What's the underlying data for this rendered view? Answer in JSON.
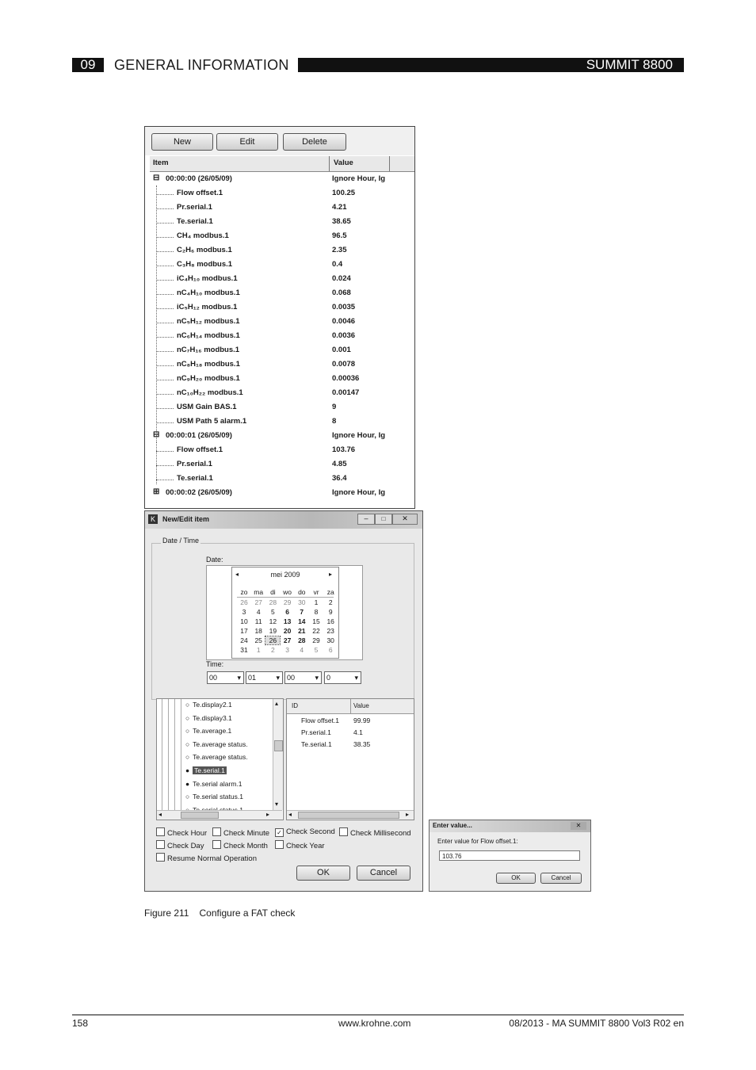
{
  "header": {
    "section_number": "09",
    "section_title": "GENERAL INFORMATION",
    "product": "SUMMIT 8800"
  },
  "panel1": {
    "buttons": {
      "new": "New",
      "edit": "Edit",
      "delete": "Delete"
    },
    "columns": {
      "item": "Item",
      "value": "Value"
    },
    "rows": [
      {
        "label": "00:00:00 (26/05/09)",
        "value": "Ignore Hour, Ig",
        "level": 0,
        "expander": "⊟"
      },
      {
        "label": "Flow offset.1",
        "value": "100.25",
        "level": 1
      },
      {
        "label": "Pr.serial.1",
        "value": "4.21",
        "level": 1
      },
      {
        "label": "Te.serial.1",
        "value": "38.65",
        "level": 1
      },
      {
        "label": "CH₄ modbus.1",
        "value": "96.5",
        "level": 1
      },
      {
        "label": "C₂H₆ modbus.1",
        "value": "2.35",
        "level": 1
      },
      {
        "label": "C₃H₈ modbus.1",
        "value": "0.4",
        "level": 1
      },
      {
        "label": "iC₄H₁₀ modbus.1",
        "value": "0.024",
        "level": 1
      },
      {
        "label": "nC₄H₁₀ modbus.1",
        "value": "0.068",
        "level": 1
      },
      {
        "label": "iC₅H₁₂ modbus.1",
        "value": "0.0035",
        "level": 1
      },
      {
        "label": "nC₅H₁₂ modbus.1",
        "value": "0.0046",
        "level": 1
      },
      {
        "label": "nC₆H₁₄ modbus.1",
        "value": "0.0036",
        "level": 1
      },
      {
        "label": "nC₇H₁₆ modbus.1",
        "value": "0.001",
        "level": 1
      },
      {
        "label": "nC₈H₁₈ modbus.1",
        "value": "0.0078",
        "level": 1
      },
      {
        "label": "nC₉H₂₀ modbus.1",
        "value": "0.00036",
        "level": 1
      },
      {
        "label": "nC₁₀H₂₂ modbus.1",
        "value": "0.00147",
        "level": 1
      },
      {
        "label": "USM Gain BAS.1",
        "value": "9",
        "level": 1
      },
      {
        "label": "USM Path 5 alarm.1",
        "value": "8",
        "level": 1
      },
      {
        "label": "00:00:01 (26/05/09)",
        "value": "Ignore Hour, Ig",
        "level": 0,
        "expander": "⊟"
      },
      {
        "label": "Flow offset.1",
        "value": "103.76",
        "level": 1
      },
      {
        "label": "Pr.serial.1",
        "value": "4.85",
        "level": 1
      },
      {
        "label": "Te.serial.1",
        "value": "36.4",
        "level": 1
      },
      {
        "label": "00:00:02 (26/05/09)",
        "value": "Ignore Hour, Ig",
        "level": 0,
        "expander": "⊞"
      }
    ]
  },
  "panel2": {
    "title": "New/Edit item",
    "group_label": "Date / Time",
    "date_label": "Date:",
    "time_label": "Time:",
    "calendar": {
      "month": "mei 2009",
      "weekdays": [
        "zo",
        "ma",
        "di",
        "wo",
        "do",
        "vr",
        "za"
      ],
      "weeks": [
        [
          "26",
          "27",
          "28",
          "29",
          "30",
          "1",
          "2"
        ],
        [
          "3",
          "4",
          "5",
          "6",
          "7",
          "8",
          "9"
        ],
        [
          "10",
          "11",
          "12",
          "13",
          "14",
          "15",
          "16"
        ],
        [
          "17",
          "18",
          "19",
          "20",
          "21",
          "22",
          "23"
        ],
        [
          "24",
          "25",
          "26",
          "27",
          "28",
          "29",
          "30"
        ],
        [
          "31",
          "1",
          "2",
          "3",
          "4",
          "5",
          "6"
        ]
      ]
    },
    "time_values": [
      "00",
      "01",
      "00",
      "0"
    ],
    "tree_items": [
      "Te.display2.1",
      "Te.display3.1",
      "Te.average.1",
      "Te.average status.",
      "Te.average status.",
      "Te.serial.1",
      "Te.serial alarm.1",
      "Te.serial status.1",
      "Te.serial status.1"
    ],
    "list_columns": {
      "id": "ID",
      "value": "Value"
    },
    "list_rows": [
      {
        "id": "Flow offset.1",
        "value": "99.99"
      },
      {
        "id": "Pr.serial.1",
        "value": "4.1"
      },
      {
        "id": "Te.serial.1",
        "value": "38.35"
      }
    ],
    "checks": {
      "hour": "Check Hour",
      "minute": "Check Minute",
      "second": "Check Second",
      "millisecond": "Check Millisecond",
      "day": "Check Day",
      "month": "Check Month",
      "year": "Check Year",
      "resume": "Resume Normal Operation"
    },
    "ok": "OK",
    "cancel": "Cancel"
  },
  "panel3": {
    "title": "Enter value...",
    "prompt": "Enter value for Flow offset.1:",
    "input_value": "103.76",
    "ok": "OK",
    "cancel": "Cancel"
  },
  "caption": {
    "number": "Figure 211",
    "text": "Configure a FAT check"
  },
  "footer": {
    "page": "158",
    "url": "www.krohne.com",
    "doc": "08/2013 - MA SUMMIT 8800 Vol3 R02 en"
  }
}
